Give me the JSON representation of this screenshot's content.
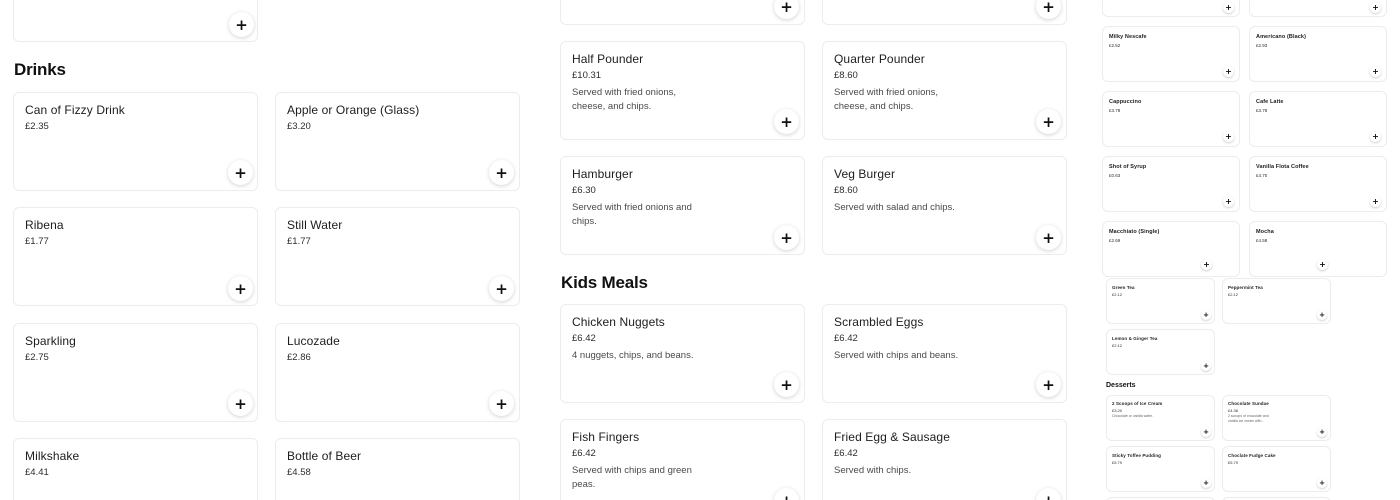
{
  "left": {
    "drinks_title": "Drinks",
    "items": [
      {
        "name": "Can of Fizzy Drink",
        "price": "£2.35"
      },
      {
        "name": "Apple or Orange (Glass)",
        "price": "£3.20"
      },
      {
        "name": "Ribena",
        "price": "£1.77"
      },
      {
        "name": "Still Water",
        "price": "£1.77"
      },
      {
        "name": "Sparkling",
        "price": "£2.75"
      },
      {
        "name": "Lucozade",
        "price": "£2.86"
      },
      {
        "name": "Milkshake",
        "price": "£4.41"
      },
      {
        "name": "Bottle of Beer",
        "price": "£4.58"
      }
    ]
  },
  "middle": {
    "kids_title": "Kids Meals",
    "items": [
      {
        "name": "Half Pounder",
        "price": "£10.31",
        "desc1": "Served with fried onions,",
        "desc2": "cheese, and chips."
      },
      {
        "name": "Quarter Pounder",
        "price": "£8.60",
        "desc1": "Served with fried onions,",
        "desc2": "cheese, and chips."
      },
      {
        "name": "Hamburger",
        "price": "£6.30",
        "desc1": "Served with fried onions and",
        "desc2": "chips."
      },
      {
        "name": "Veg Burger",
        "price": "£8.60",
        "desc1": "Served with salad and chips.",
        "desc2": ""
      },
      {
        "name": "Chicken Nuggets",
        "price": "£6.42",
        "desc1": "4 nuggets, chips, and beans.",
        "desc2": ""
      },
      {
        "name": "Scrambled Eggs",
        "price": "£6.42",
        "desc1": "Served with chips and beans.",
        "desc2": ""
      },
      {
        "name": "Fish Fingers",
        "price": "£6.42",
        "desc1": "Served with chips and green",
        "desc2": "peas."
      },
      {
        "name": "Fried Egg & Sausage",
        "price": "£6.42",
        "desc1": "Served with chips.",
        "desc2": ""
      }
    ]
  },
  "right": {
    "desserts_title": "Desserts",
    "items": [
      {
        "name": "Milky Nescafe",
        "price": "£2.52"
      },
      {
        "name": "Americano (Black)",
        "price": "£2.93"
      },
      {
        "name": "Cappuccino",
        "price": "£3.78"
      },
      {
        "name": "Cafe Latte",
        "price": "£3.78"
      },
      {
        "name": "Shot of Syrup",
        "price": "£0.63"
      },
      {
        "name": "Vanilla Flota Coffee",
        "price": "£4.70"
      },
      {
        "name": "Macchiato (Single)",
        "price": "£2.69"
      },
      {
        "name": "Mocha",
        "price": "£4.58"
      },
      {
        "name": "Green Tea",
        "price": "£2.12"
      },
      {
        "name": "Peppermint Tea",
        "price": "£2.12"
      },
      {
        "name": "Lemon & Ginger Tea",
        "price": "£2.12"
      },
      {
        "name": "2 Scoops of Ice Cream",
        "price": "£3.20",
        "desc1": "Chocolate or vanilla wafer.",
        "desc2": ""
      },
      {
        "name": "Chocolate Sundae",
        "price": "£4.36",
        "desc1": "2 scoops of chocolate and",
        "desc2": "vanilla ice cream with..."
      },
      {
        "name": "Sticky Toffee Pudding",
        "price": "£5.79"
      },
      {
        "name": "Choclate Fudge Cake",
        "price": "£5.79"
      }
    ]
  },
  "add_glyph": "+"
}
